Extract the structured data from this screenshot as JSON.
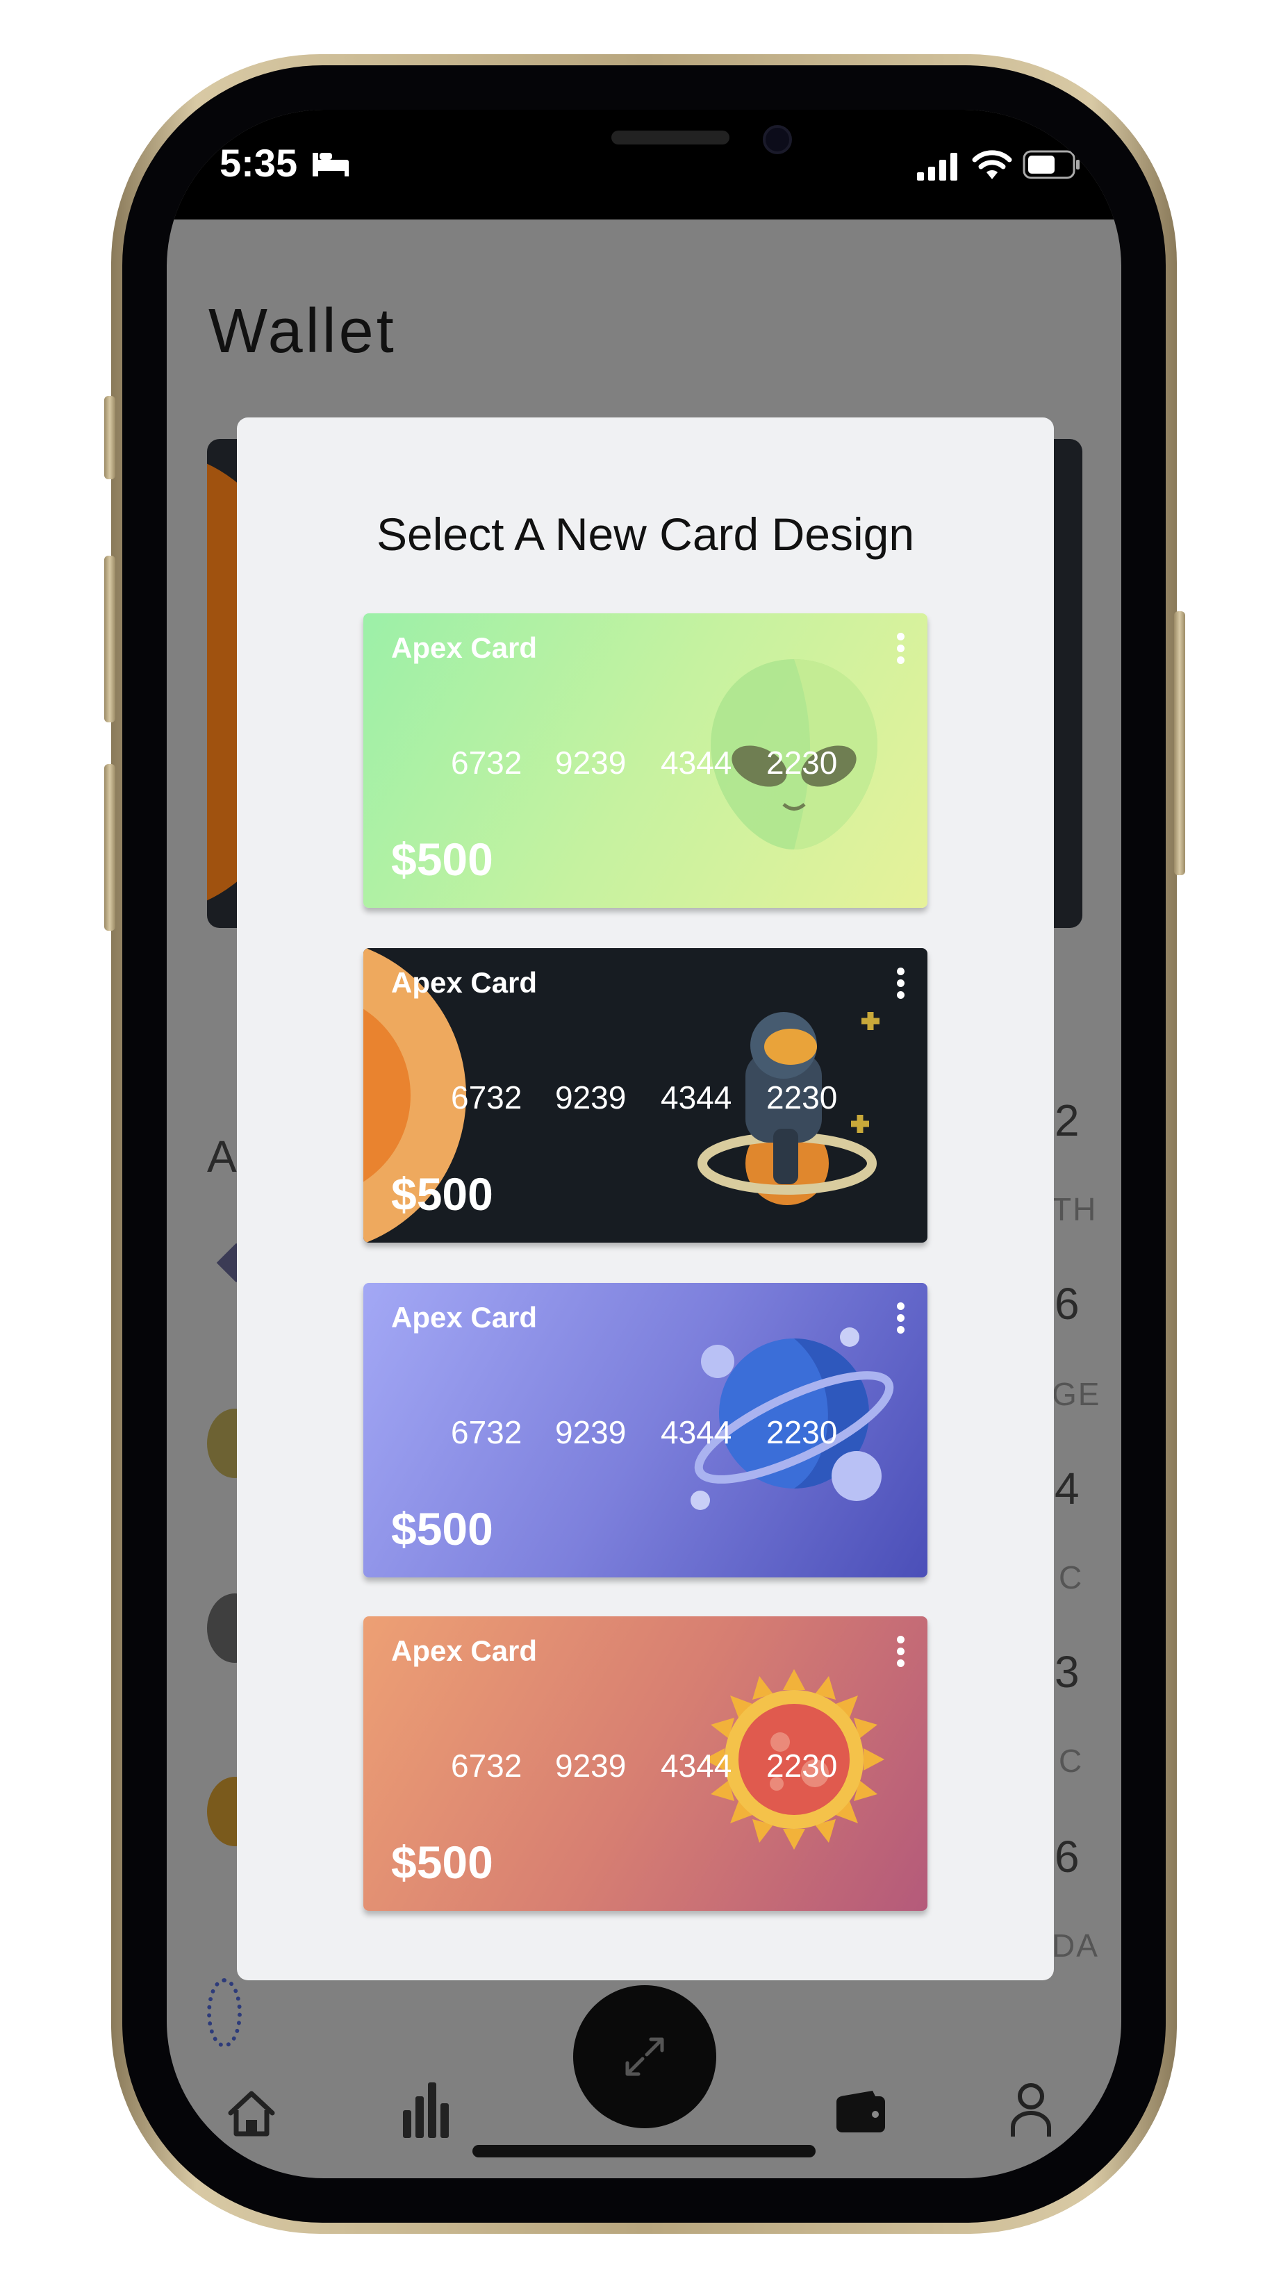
{
  "status_bar": {
    "time": "5:35"
  },
  "background": {
    "title": "Wallet",
    "section_initial": "A",
    "assets": [
      {
        "value": "2",
        "ticker": "TH"
      },
      {
        "value": "6",
        "ticker": "GE"
      },
      {
        "value": "4",
        "ticker": "C"
      },
      {
        "value": "3",
        "ticker": "C"
      },
      {
        "value": "6",
        "ticker": "DA"
      }
    ]
  },
  "modal": {
    "title": "Select A New Card Design",
    "cards": [
      {
        "brand": "Apex Card",
        "numbers": [
          "6732",
          "9239",
          "4344",
          "2230"
        ],
        "amount": "$500",
        "theme": "alien",
        "colors": [
          "#9cf0a8",
          "#e4f29a"
        ]
      },
      {
        "brand": "Apex Card",
        "numbers": [
          "6732",
          "9239",
          "4344",
          "2230"
        ],
        "amount": "$500",
        "theme": "astronaut",
        "colors": [
          "#171c22",
          "#171c22"
        ]
      },
      {
        "brand": "Apex Card",
        "numbers": [
          "6732",
          "9239",
          "4344",
          "2230"
        ],
        "amount": "$500",
        "theme": "planet",
        "colors": [
          "#a3a8f5",
          "#4b4fb8"
        ]
      },
      {
        "brand": "Apex Card",
        "numbers": [
          "6732",
          "9239",
          "4344",
          "2230"
        ],
        "amount": "$500",
        "theme": "sun",
        "colors": [
          "#eda074",
          "#b45a7a"
        ]
      }
    ]
  },
  "nav": {
    "items": [
      {
        "icon": "home-icon"
      },
      {
        "icon": "stats-icon"
      },
      {
        "icon": "transfer-icon"
      },
      {
        "icon": "wallet-icon"
      },
      {
        "icon": "profile-icon"
      }
    ]
  }
}
